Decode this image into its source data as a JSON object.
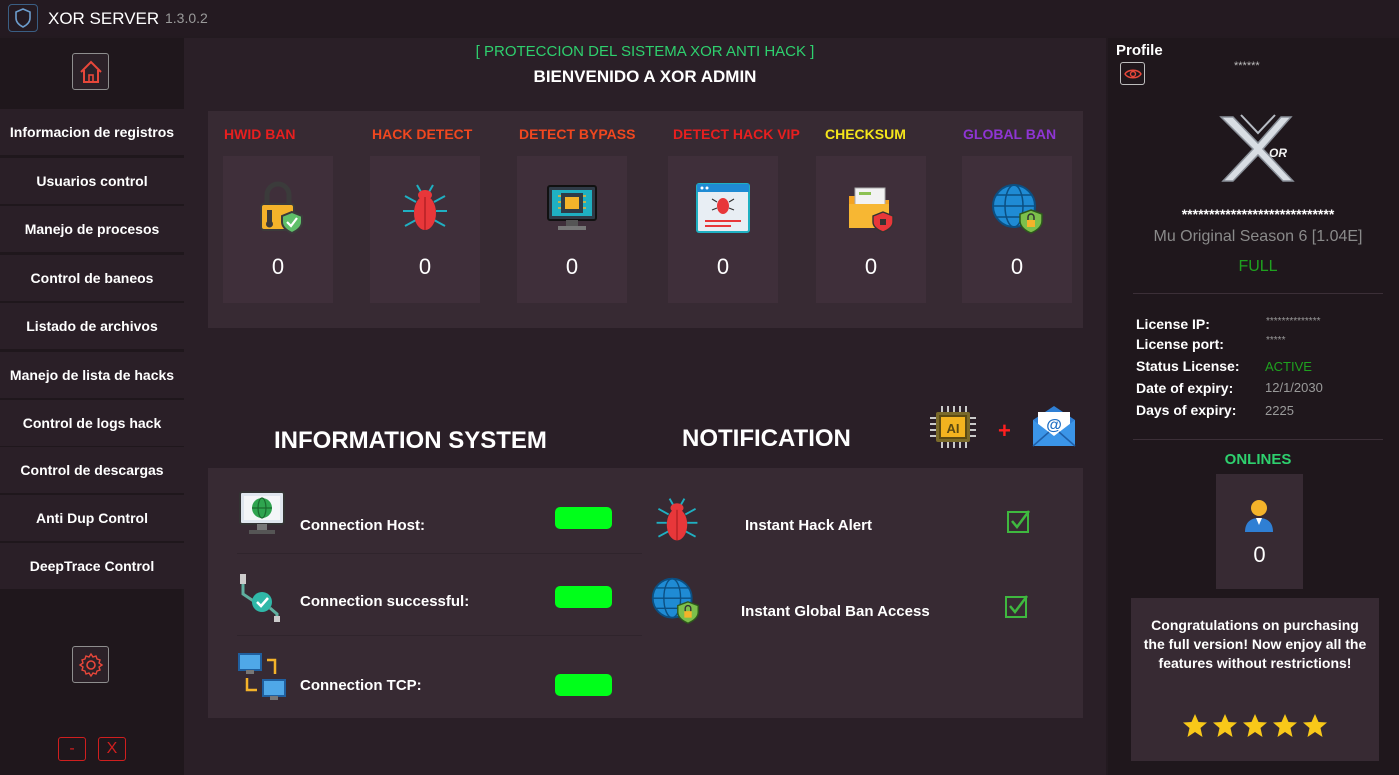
{
  "titlebar": {
    "title": "XOR SERVER",
    "version": "1.3.0.2"
  },
  "sidebar": {
    "items": [
      {
        "label": "Informacion de registros"
      },
      {
        "label": "Usuarios control"
      },
      {
        "label": "Manejo de procesos"
      },
      {
        "label": "Control de baneos"
      },
      {
        "label": "Listado de archivos"
      },
      {
        "label": "Manejo de lista de hacks"
      },
      {
        "label": "Control de logs hack"
      },
      {
        "label": "Control de descargas"
      },
      {
        "label": "Anti Dup Control"
      },
      {
        "label": "DeepTrace Control"
      }
    ],
    "minimize_label": "-",
    "close_label": "X"
  },
  "main": {
    "subtitle": "[ PROTECCION DEL SISTEMA XOR ANTI HACK ]",
    "title": "BIENVENIDO A XOR ADMIN",
    "stats": [
      {
        "label": "HWID BAN",
        "value": "0",
        "color": "#e81f1f",
        "icon": "padlock-shield-icon"
      },
      {
        "label": "HACK DETECT",
        "value": "0",
        "color": "#f0471f",
        "icon": "bug-icon"
      },
      {
        "label": "DETECT BYPASS",
        "value": "0",
        "color": "#f0471f",
        "icon": "computer-chip-icon"
      },
      {
        "label": "DETECT HACK VIP",
        "value": "0",
        "color": "#e81f1f",
        "icon": "browser-bug-icon"
      },
      {
        "label": "CHECKSUM",
        "value": "0",
        "color": "#f5e61b",
        "icon": "folder-shield-icon"
      },
      {
        "label": "GLOBAL BAN",
        "value": "0",
        "color": "#8f35d4",
        "icon": "globe-lock-icon"
      }
    ],
    "info_heading": "INFORMATION SYSTEM",
    "notif_heading": "NOTIFICATION",
    "plus": "+",
    "info_rows": [
      {
        "label": "Connection Host:",
        "icon": "monitor-globe-icon",
        "status_color": "#00ff1a"
      },
      {
        "label": "Connection successful:",
        "icon": "plug-check-icon",
        "status_color": "#00ff1a"
      },
      {
        "label": "Connection TCP:",
        "icon": "network-computers-icon",
        "status_color": "#00ff1a"
      }
    ],
    "notifications": [
      {
        "label": "Instant Hack Alert",
        "icon": "bug-icon",
        "checked": true
      },
      {
        "label": "Instant Global Ban Access",
        "icon": "globe-lock-icon",
        "checked": true
      }
    ]
  },
  "right": {
    "profile_label": "Profile",
    "profile_user": "******",
    "masked_key": "****************************",
    "server_name": "Mu Original Season 6 [1.04E]",
    "edition": "FULL",
    "license": [
      {
        "label": "License IP:",
        "value": "**************",
        "color": "#9a9a9a"
      },
      {
        "label": "License port:",
        "value": "*****",
        "color": "#9a9a9a"
      },
      {
        "label": "Status License:",
        "value": "ACTIVE",
        "color": "#1fa21f"
      },
      {
        "label": "Date of expiry:",
        "value": "12/1/2030",
        "color": "#9a9a9a"
      },
      {
        "label": "Days of expiry:",
        "value": "2225",
        "color": "#9a9a9a"
      }
    ],
    "onlines_label": "ONLINES",
    "onlines_count": "0",
    "promo": "Congratulations on purchasing the full version! Now enjoy all the features without restrictions!",
    "rating": 5
  },
  "colors": {
    "accent_green": "#2ed06e",
    "status_on": "#00ff1a",
    "danger": "#d01f1f"
  }
}
